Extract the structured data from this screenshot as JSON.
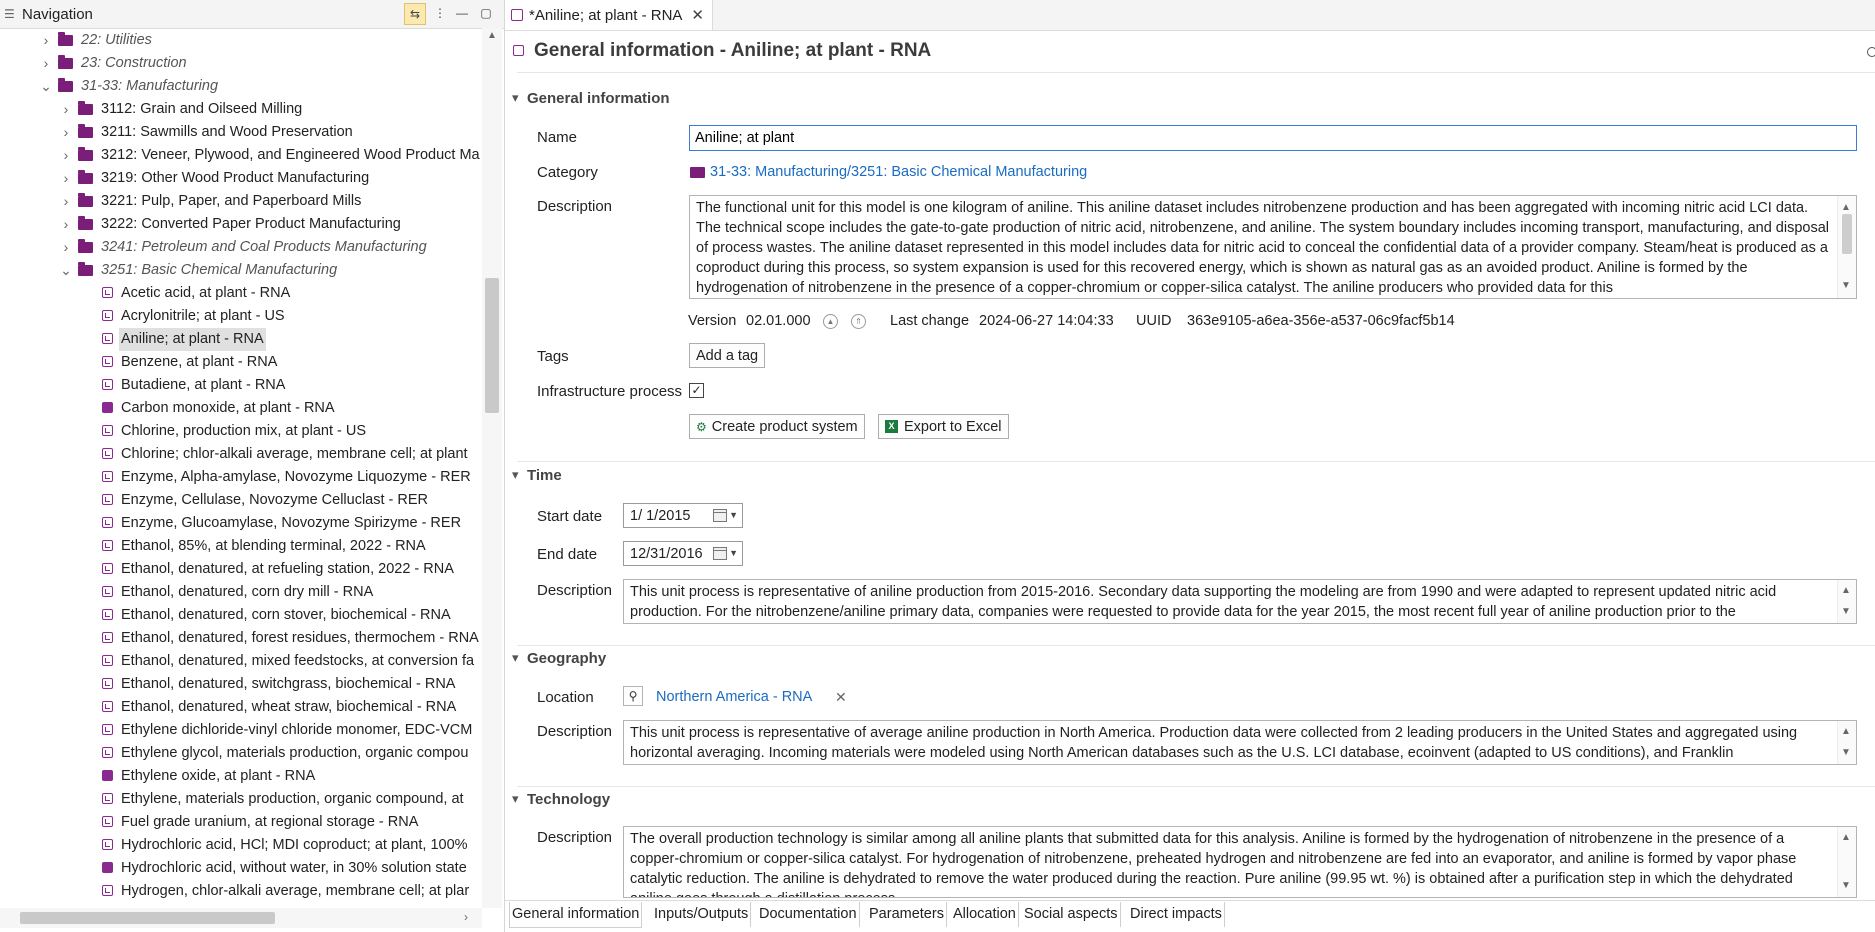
{
  "nav": {
    "title": "Navigation",
    "items": [
      {
        "label": "22: Utilities",
        "kind": "folder",
        "italic": true,
        "arrow": "›"
      },
      {
        "label": "23: Construction",
        "kind": "folder",
        "italic": true,
        "arrow": "›"
      },
      {
        "label": "31-33: Manufacturing",
        "kind": "folder",
        "italic": true,
        "arrow": "⌄"
      },
      {
        "label": "3112: Grain and Oilseed Milling",
        "kind": "folder",
        "italic": false,
        "arrow": "›"
      },
      {
        "label": "3211: Sawmills and Wood Preservation",
        "kind": "folder",
        "italic": false,
        "arrow": "›"
      },
      {
        "label": "3212: Veneer, Plywood, and Engineered Wood Product Ma",
        "kind": "folder",
        "italic": false,
        "arrow": "›"
      },
      {
        "label": "3219: Other Wood Product Manufacturing",
        "kind": "folder",
        "italic": false,
        "arrow": "›"
      },
      {
        "label": "3221: Pulp, Paper, and Paperboard Mills",
        "kind": "folder",
        "italic": false,
        "arrow": "›"
      },
      {
        "label": "3222: Converted Paper Product Manufacturing",
        "kind": "folder",
        "italic": false,
        "arrow": "›"
      },
      {
        "label": "3241: Petroleum and Coal Products Manufacturing",
        "kind": "folder",
        "italic": true,
        "arrow": "›"
      },
      {
        "label": "3251: Basic Chemical Manufacturing",
        "kind": "folder",
        "italic": true,
        "arrow": "⌄"
      },
      {
        "label": "Acetic acid, at plant - RNA",
        "kind": "process"
      },
      {
        "label": "Acrylonitrile; at plant - US",
        "kind": "process"
      },
      {
        "label": "Aniline; at plant - RNA",
        "kind": "process",
        "selected": true
      },
      {
        "label": "Benzene, at plant - RNA",
        "kind": "process"
      },
      {
        "label": "Butadiene, at plant - RNA",
        "kind": "process"
      },
      {
        "label": "Carbon monoxide, at plant - RNA",
        "kind": "process-filled"
      },
      {
        "label": "Chlorine, production mix, at plant - US",
        "kind": "process"
      },
      {
        "label": "Chlorine; chlor-alkali average, membrane cell; at plant",
        "kind": "process"
      },
      {
        "label": "Enzyme, Alpha-amylase, Novozyme Liquozyme - RER",
        "kind": "process"
      },
      {
        "label": "Enzyme, Cellulase, Novozyme Celluclast - RER",
        "kind": "process"
      },
      {
        "label": "Enzyme, Glucoamylase, Novozyme Spirizyme - RER",
        "kind": "process"
      },
      {
        "label": "Ethanol, 85%, at blending terminal, 2022 - RNA",
        "kind": "process"
      },
      {
        "label": "Ethanol, denatured, at refueling station, 2022 - RNA",
        "kind": "process"
      },
      {
        "label": "Ethanol, denatured, corn dry mill - RNA",
        "kind": "process"
      },
      {
        "label": "Ethanol, denatured, corn stover, biochemical - RNA",
        "kind": "process"
      },
      {
        "label": "Ethanol, denatured, forest residues, thermochem - RNA",
        "kind": "process"
      },
      {
        "label": "Ethanol, denatured, mixed feedstocks, at conversion fa",
        "kind": "process"
      },
      {
        "label": "Ethanol, denatured, switchgrass, biochemical - RNA",
        "kind": "process"
      },
      {
        "label": "Ethanol, denatured, wheat straw, biochemical - RNA",
        "kind": "process"
      },
      {
        "label": "Ethylene dichloride-vinyl chloride monomer, EDC-VCM",
        "kind": "process"
      },
      {
        "label": "Ethylene glycol, materials production, organic compou",
        "kind": "process"
      },
      {
        "label": "Ethylene oxide, at plant - RNA",
        "kind": "process-filled"
      },
      {
        "label": "Ethylene, materials production, organic compound, at",
        "kind": "process"
      },
      {
        "label": "Fuel grade uranium, at regional storage - RNA",
        "kind": "process"
      },
      {
        "label": "Hydrochloric acid, HCl; MDI coproduct; at plant, 100%",
        "kind": "process"
      },
      {
        "label": "Hydrochloric acid, without water, in 30% solution state",
        "kind": "process-filled"
      },
      {
        "label": "Hydrogen, chlor-alkali average, membrane cell; at plar",
        "kind": "process"
      }
    ]
  },
  "editor": {
    "tab_title": "*Aniline; at plant - RNA",
    "header_title": "General information - Aniline; at plant - RNA",
    "general": {
      "section": "General information",
      "name_label": "Name",
      "name_value": "Aniline; at plant",
      "category_label": "Category",
      "category_value": "31-33: Manufacturing/3251: Basic Chemical Manufacturing",
      "description_label": "Description",
      "description_value": "The functional unit for this model is one kilogram of aniline. This aniline dataset includes nitrobenzene production and has been aggregated with incoming nitric acid LCI data. The technical scope includes the gate-to-gate production of nitric acid, nitrobenzene, and aniline. The system boundary includes incoming transport, manufacturing, and disposal of process wastes. The aniline dataset represented in this model includes data for nitric acid to conceal the confidential data of a provider company. Steam/heat is produced as a coproduct during this process, so system expansion is used for this recovered energy, which is shown as natural gas as an avoided product. Aniline is formed by the hydrogenation of nitrobenzene in the presence of a copper-chromium or copper-silica catalyst. The aniline producers who provided data for this",
      "version_label": "Version",
      "version_value": "02.01.000",
      "last_change_label": "Last change",
      "last_change_value": "2024-06-27 14:04:33",
      "uuid_label": "UUID",
      "uuid_value": "363e9105-a6ea-356e-a537-06c9facf5b14",
      "tags_label": "Tags",
      "add_tag": "Add a tag",
      "infra_label": "Infrastructure process",
      "create_ps": "Create product system",
      "export_excel": "Export to Excel"
    },
    "time": {
      "section": "Time",
      "start_label": "Start date",
      "start_value": "1/  1/2015",
      "end_label": "End date",
      "end_value": "12/31/2016",
      "description_label": "Description",
      "description_value": "This unit process is representative of aniline production from 2015-2016. Secondary data supporting the modeling are from 1990 and were adapted to represent updated nitric acid production. For the nitrobenzene/aniline primary data, companies were requested to provide data for the year 2015, the most recent full year of aniline production prior to the"
    },
    "geography": {
      "section": "Geography",
      "location_label": "Location",
      "location_value": "Northern America - RNA",
      "description_label": "Description",
      "description_value": "This unit process is representative of average aniline production in North America. Production data were collected from 2 leading producers in the United States and aggregated using horizontal averaging. Incoming materials were modeled using North American databases such as the U.S. LCI database, ecoinvent (adapted to US conditions), and Franklin"
    },
    "technology": {
      "section": "Technology",
      "description_label": "Description",
      "description_value": "The overall production technology is similar among all aniline plants that submitted data for this analysis. Aniline is formed by the hydrogenation of nitrobenzene in the presence of a copper-chromium or copper-silica catalyst. For hydrogenation of nitrobenzene, preheated hydrogen and nitrobenzene are fed into an evaporator, and aniline is formed by vapor phase catalytic reduction. The aniline is dehydrated to remove the water produced during the reaction. Pure aniline (99.95 wt. %) is obtained after a purification step in which the dehydrated aniline goes through a distillation process."
    },
    "bottom_tabs": [
      "General information",
      "Inputs/Outputs",
      "Documentation",
      "Parameters",
      "Allocation",
      "Social aspects",
      "Direct impacts"
    ]
  },
  "colors": {
    "accent": "#1a6bc2",
    "folder": "#7b1e7a",
    "process": "#8a2a8f",
    "excel": "#1d7a3e"
  }
}
